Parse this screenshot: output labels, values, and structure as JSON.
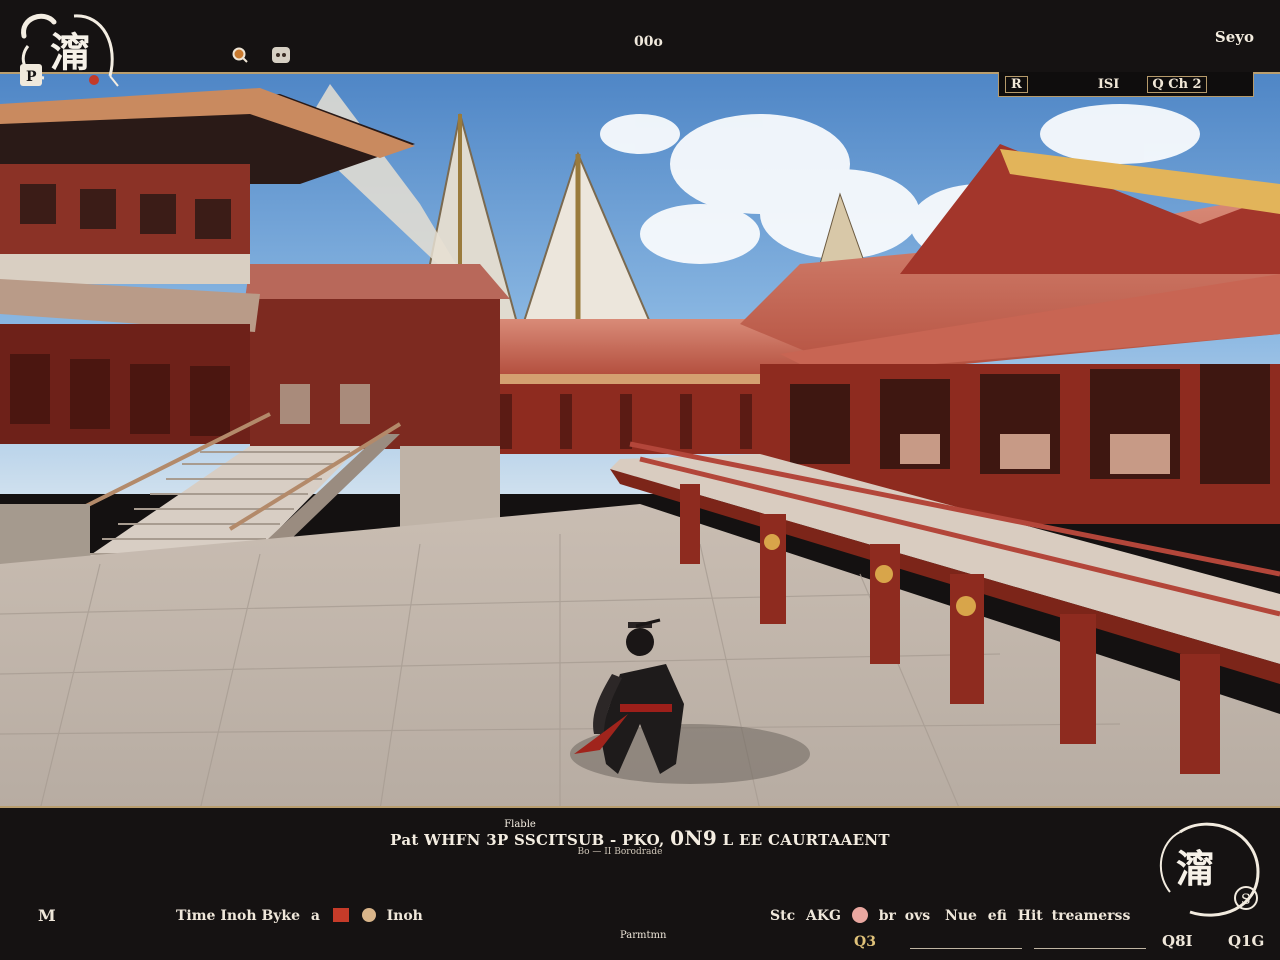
{
  "header": {
    "logo_glyph": "澝",
    "logo_sub": "P",
    "top_icon_1": "Q",
    "top_icon_2": "Q",
    "center_title": "00o",
    "right_title": "Seyo",
    "status_left": "R",
    "status_mid": "ISI",
    "status_right": "Q Ch 2"
  },
  "subtitle": {
    "small": "Flable",
    "main_text": "Pat WHFN 3P SSCITSUB - PKO,",
    "main_bold": "0N9",
    "main_suffix": "L EE CAURTAAENT",
    "tiny": "Bo — II Borodrade"
  },
  "bottom": {
    "left_marker": "M",
    "hint_text": "Time Inoh Byke",
    "hint_mid": "a",
    "hint_end": "Inoh",
    "center_label": "Parmtmn",
    "action_a": "Stc",
    "action_b": "AKG",
    "action_c": "br",
    "action_d": "ovs",
    "action_e": "Nue",
    "action_f": "efi",
    "action_g": "Hit",
    "action_h": "treamerss",
    "stat_1": "Q8I",
    "stat_2": "Q1G",
    "badge": "Q3",
    "emblem_glyph": "澝",
    "emblem_sub": "S"
  },
  "colors": {
    "accent_gold": "#b99e6f",
    "hud_bg": "#151212",
    "roof_red": "#c2564a",
    "timber_red": "#8e2b1f",
    "sky": "#7aaee0"
  },
  "icons": [
    "ink-emblem-icon",
    "search-icon",
    "portrait-icon",
    "crossed-swords-icon",
    "coin-icon",
    "gear-icon"
  ]
}
